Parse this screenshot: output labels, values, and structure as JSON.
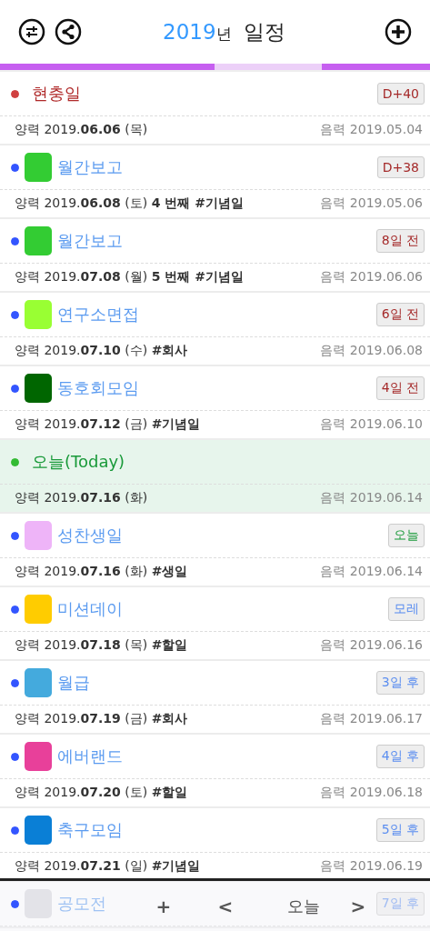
{
  "header": {
    "year": "2019",
    "title": "년 일정"
  },
  "events": [
    {
      "kind": "holiday",
      "color": "#d04040",
      "title": "현충일",
      "badge": {
        "text": "D+40",
        "kind": "past"
      },
      "solar": "양력 2019.**06.06** (목)",
      "lunar": "음력 2019.05.04"
    },
    {
      "kind": "event",
      "color": "#3355ff",
      "swatch": {
        "color": "#33cc33"
      },
      "title": "월간보고",
      "badge": {
        "text": "D+38",
        "kind": "past"
      },
      "solar": "양력 2019.**06.08** (토) **4 번째  #기념일**",
      "lunar": "음력 2019.05.06"
    },
    {
      "kind": "event",
      "color": "#3355ff",
      "swatch": {
        "color": "#33cc33"
      },
      "title": "월간보고",
      "badge": {
        "text": "8일 전",
        "kind": "past"
      },
      "solar": "양력 2019.**07.08** (월) **5 번째  #기념일**",
      "lunar": "음력 2019.06.06"
    },
    {
      "kind": "event",
      "color": "#3355ff",
      "swatch": {
        "color": "#99ff33"
      },
      "title": "연구소면접",
      "badge": {
        "text": "6일 전",
        "kind": "past"
      },
      "solar": "양력 2019.**07.10** (수)  **#회사**",
      "lunar": "음력 2019.06.08"
    },
    {
      "kind": "event",
      "color": "#3355ff",
      "swatch": {
        "color": "#006600"
      },
      "title": "동호회모임",
      "badge": {
        "text": "4일 전",
        "kind": "past"
      },
      "solar": "양력 2019.**07.12** (금)  **#기념일**",
      "lunar": "음력 2019.06.10"
    },
    {
      "kind": "today",
      "color": "#33bb33",
      "title": "오늘(Today)",
      "solar": "양력 2019.**07.16** (화)",
      "lunar": "음력 2019.06.14"
    },
    {
      "kind": "event",
      "color": "#3355ff",
      "swatch": {
        "color": "#eeb4f8"
      },
      "title": "성찬생일",
      "badge": {
        "text": "오늘",
        "kind": "today"
      },
      "solar": "양력 2019.**07.16** (화)  **#생일**",
      "lunar": "음력 2019.06.14"
    },
    {
      "kind": "event",
      "color": "#3355ff",
      "swatch": {
        "color": "#ffcc00"
      },
      "title": "미션데이",
      "badge": {
        "text": "모레",
        "kind": "future"
      },
      "solar": "양력 2019.**07.18** (목)  **#할일**",
      "lunar": "음력 2019.06.16"
    },
    {
      "kind": "event",
      "color": "#3355ff",
      "swatch": {
        "color": "#44aadd"
      },
      "title": "월급",
      "badge": {
        "text": "3일 후",
        "kind": "future"
      },
      "solar": "양력 2019.**07.19** (금)  **#회사**",
      "lunar": "음력 2019.06.17"
    },
    {
      "kind": "event",
      "color": "#3355ff",
      "swatch": {
        "color": "#e8409a"
      },
      "title": "에버랜드",
      "badge": {
        "text": "4일 후",
        "kind": "future"
      },
      "solar": "양력 2019.**07.20** (토)  **#할일**",
      "lunar": "음력 2019.06.18"
    },
    {
      "kind": "event",
      "color": "#3355ff",
      "swatch": {
        "color": "#0a7fd6"
      },
      "title": "축구모임",
      "badge": {
        "text": "5일 후",
        "kind": "future"
      },
      "solar": "양력 2019.**07.21** (일)  **#기념일**",
      "lunar": "음력 2019.06.19"
    },
    {
      "kind": "event",
      "color": "#3355ff",
      "swatch": {
        "color": "#d8d8dc"
      },
      "title": "공모전",
      "badge": {
        "text": "7일 후",
        "kind": "future"
      }
    }
  ],
  "toolbar": [
    "+",
    "<",
    "오늘",
    ">"
  ]
}
